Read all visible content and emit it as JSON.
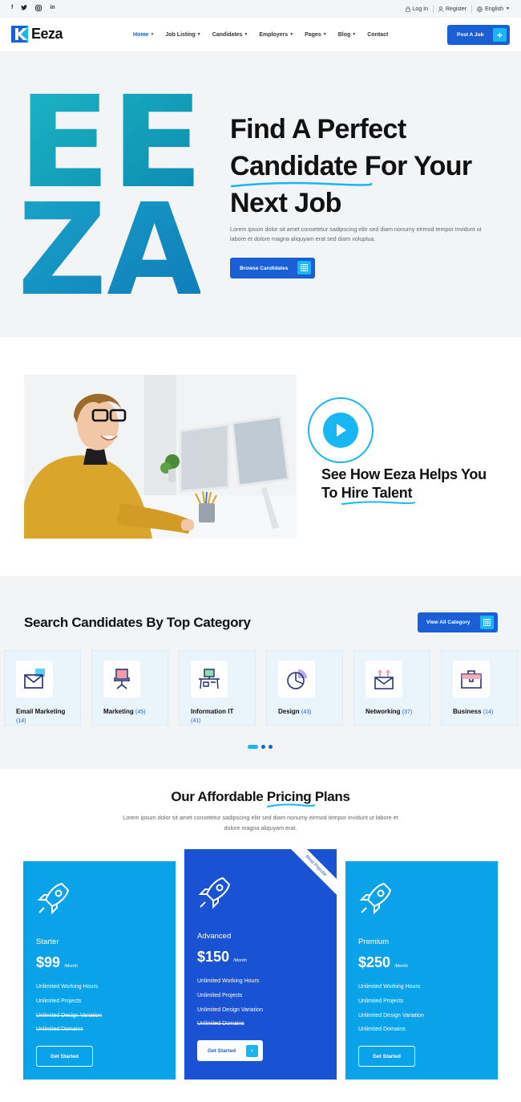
{
  "topbar": {
    "social": [
      "f",
      "t",
      "ig",
      "in"
    ],
    "login": "Log In",
    "register": "Register",
    "language": "English"
  },
  "header": {
    "logo_text": "Eeza",
    "nav": [
      "Home",
      "Job Listing",
      "Candidates",
      "Employers",
      "Pages",
      "Blog",
      "Contact"
    ],
    "post_job": "Post A Job"
  },
  "hero": {
    "letters_line1": "EE",
    "letters_line2": "ZA",
    "title_line1": "Find A Perfect",
    "title_underlined": "Candidate",
    "title_line2_rest": " For Your",
    "title_line3": "Next Job",
    "description": "Lorem ipsum dolor sit amet consetetur sadipscing elitr sed diam nonumy eirmod tempor invidunt ut labore et dolore magna aliquyam erat sed diam voluptua.",
    "button": "Browse Candidates"
  },
  "video": {
    "title_line1": "See How Eeza Helps You",
    "title_line2_a": "To ",
    "title_line2_underlined": "Hire Talent"
  },
  "categories": {
    "title": "Search Candidates By Top Category",
    "view_all": "View All Category",
    "items": [
      {
        "name": "Email Marketing",
        "count": "(14)"
      },
      {
        "name": "Marketing",
        "count": "(45)"
      },
      {
        "name": "Information IT",
        "count": "(41)"
      },
      {
        "name": "Design",
        "count": "(43)"
      },
      {
        "name": "Networking",
        "count": "(37)"
      },
      {
        "name": "Business",
        "count": "(14)"
      }
    ]
  },
  "pricing": {
    "title_a": "Our Affordable ",
    "title_underlined": "Pricing",
    "title_b": " Plans",
    "description": "Lorem ipsum dolor sit amet consetetur sadipscing elitr sed diam nonumy eirmod tempor invidunt ut labore et dolore magna aliquyam erat.",
    "plans": [
      {
        "name": "Starter",
        "price": "$99",
        "period": "/Month",
        "features": [
          "Unlimited Working Hours",
          "Unlimited Projects",
          "Unlimited Design Variation",
          "Unlimited Domains"
        ],
        "button": "Get Started"
      },
      {
        "name": "Advanced",
        "price": "$150",
        "period": "/Month",
        "features": [
          "Unlimited Working Hours",
          "Unlimited Projects",
          "Unlimited Design Variation",
          "Unlimited Domains"
        ],
        "button": "Get Started",
        "badge": "Most Popular"
      },
      {
        "name": "Premium",
        "price": "$250",
        "period": "/Month",
        "features": [
          "Unlimited Working Hours",
          "Unlimited Projects",
          "Unlimited Design Variation",
          "Unlimited Domains"
        ],
        "button": "Get Started"
      }
    ]
  },
  "colors": {
    "primary": "#1a5fd6",
    "accent": "#18b6f2",
    "plan_light": "#0aa3ea",
    "plan_dark": "#1a52d4"
  }
}
